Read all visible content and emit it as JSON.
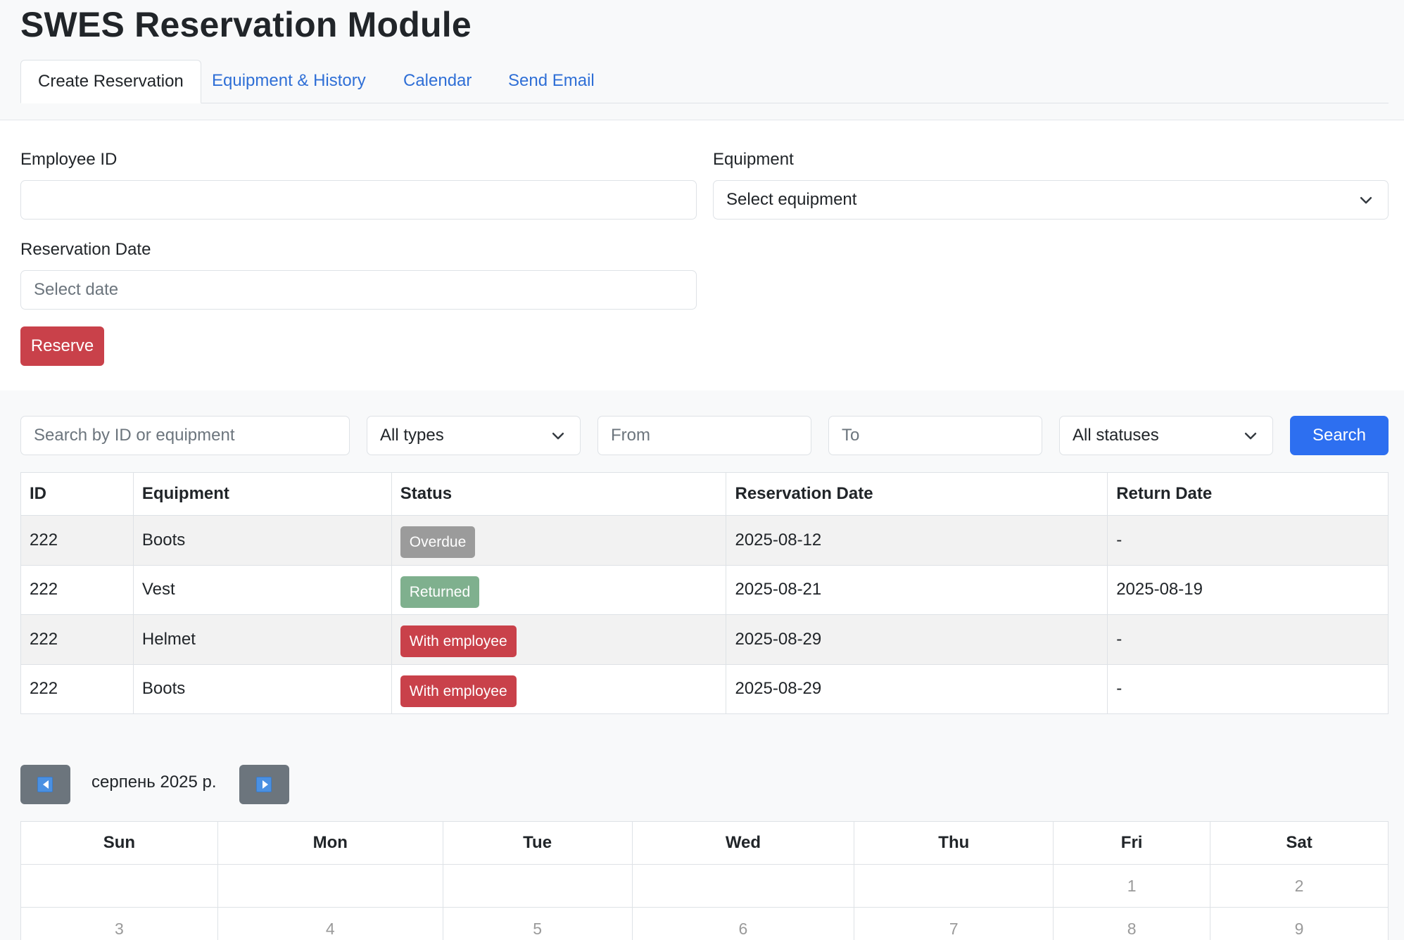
{
  "app": {
    "title": "SWES Reservation Module"
  },
  "tabs": [
    {
      "label": "Create Reservation",
      "active": true
    },
    {
      "label": "Equipment & History",
      "active": false
    },
    {
      "label": "Calendar",
      "active": false
    },
    {
      "label": "Send Email",
      "active": false
    }
  ],
  "form": {
    "employee_id": {
      "label": "Employee ID",
      "value": ""
    },
    "equipment": {
      "label": "Equipment",
      "selected": "Select equipment"
    },
    "reservation_date": {
      "label": "Reservation Date",
      "placeholder": "Select date"
    },
    "reserve_label": "Reserve"
  },
  "filters": {
    "search_placeholder": "Search by ID or equipment",
    "type_selected": "All types",
    "from_placeholder": "From",
    "to_placeholder": "To",
    "status_selected": "All statuses",
    "search_label": "Search"
  },
  "table": {
    "headers": [
      "ID",
      "Equipment",
      "Status",
      "Reservation Date",
      "Return Date"
    ],
    "rows": [
      {
        "id": "222",
        "equipment": "Boots",
        "status": "Overdue",
        "reservation_date": "2025-08-12",
        "return_date": "-"
      },
      {
        "id": "222",
        "equipment": "Vest",
        "status": "Returned",
        "reservation_date": "2025-08-21",
        "return_date": "2025-08-19"
      },
      {
        "id": "222",
        "equipment": "Helmet",
        "status": "With employee",
        "reservation_date": "2025-08-29",
        "return_date": "-"
      },
      {
        "id": "222",
        "equipment": "Boots",
        "status": "With employee",
        "reservation_date": "2025-08-29",
        "return_date": "-"
      }
    ]
  },
  "status_colors": {
    "Overdue": "#9b9b9b",
    "Returned": "#7fb08e",
    "With employee": "#c9414a"
  },
  "calendar": {
    "month_label": "серпень 2025 р.",
    "weekdays": [
      "Sun",
      "Mon",
      "Tue",
      "Wed",
      "Thu",
      "Fri",
      "Sat"
    ],
    "weeks": [
      [
        "",
        "",
        "",
        "",
        "",
        "1",
        "2"
      ],
      [
        "3",
        "4",
        "5",
        "6",
        "7",
        "8",
        "9"
      ]
    ]
  },
  "colors": {
    "accent": "#2d6ff0",
    "danger": "#c9414a",
    "link": "#2f6fd6"
  }
}
